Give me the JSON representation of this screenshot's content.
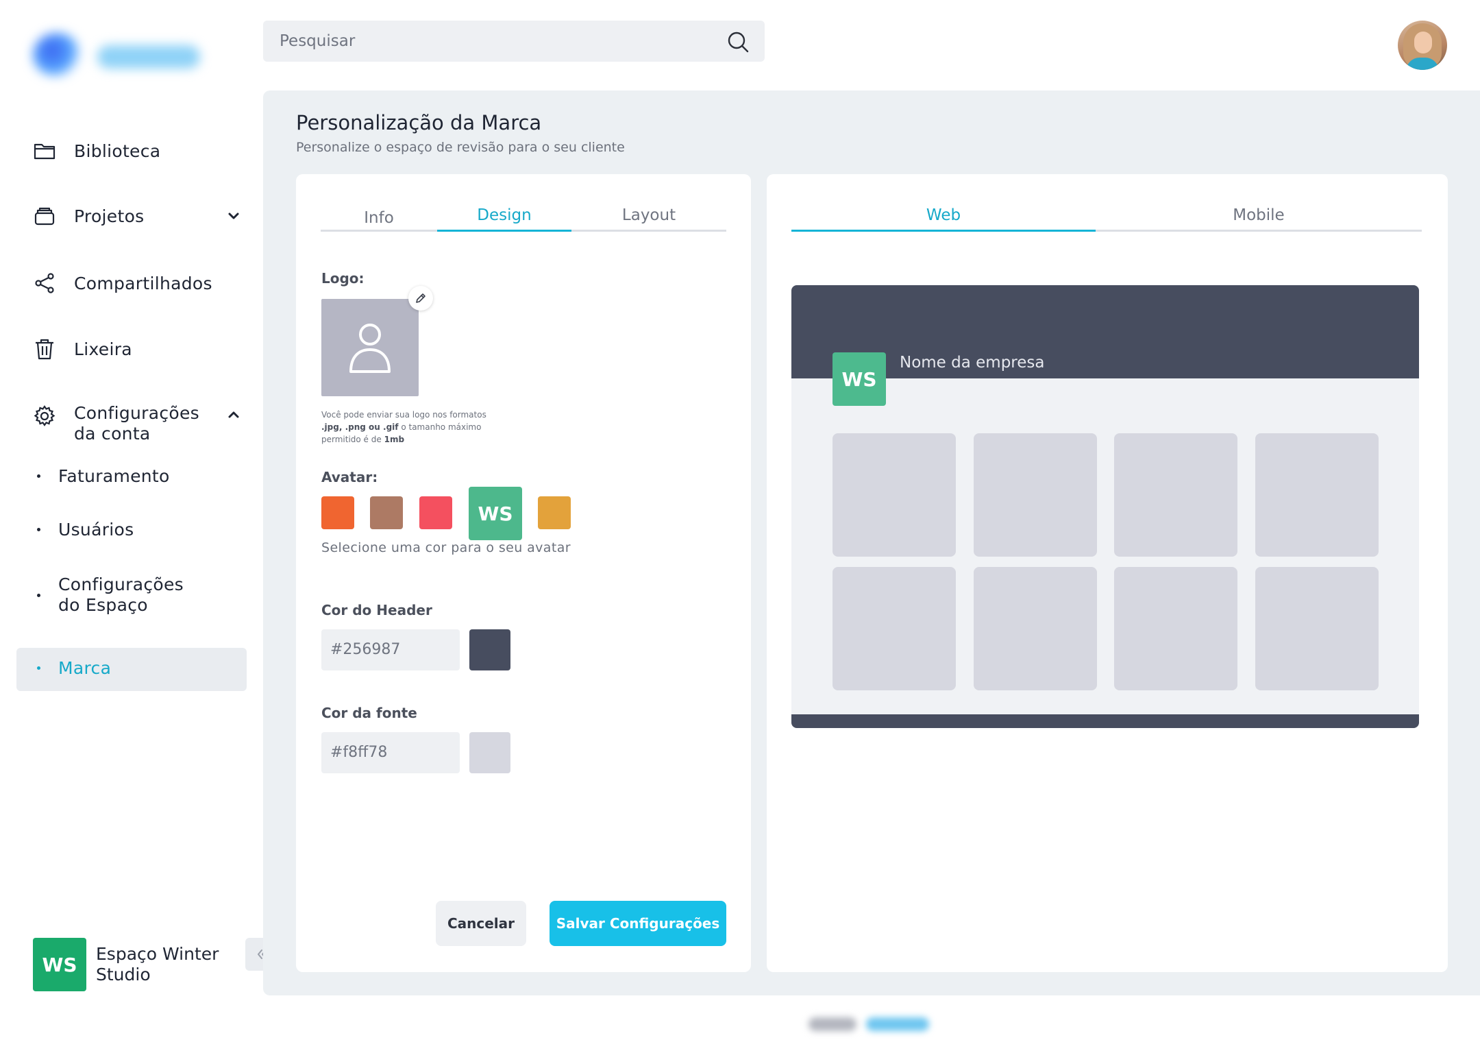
{
  "search": {
    "placeholder": "Pesquisar",
    "value": ""
  },
  "sidebar": {
    "items": [
      {
        "label": "Biblioteca",
        "icon": "folder-icon"
      },
      {
        "label": "Projetos",
        "icon": "projects-icon",
        "expandable": true,
        "expanded": false
      },
      {
        "label": "Compartilhados",
        "icon": "share-icon"
      },
      {
        "label": "Lixeira",
        "icon": "trash-icon"
      },
      {
        "label": "Configurações da conta",
        "icon": "gear-icon",
        "expandable": true,
        "expanded": true
      }
    ],
    "subitems": [
      {
        "label": "Faturamento",
        "active": false
      },
      {
        "label": "Usuários",
        "active": false
      },
      {
        "label": "Configurações do Espaço",
        "active": false
      },
      {
        "label": "Marca",
        "active": true
      }
    ],
    "workspace": {
      "initials": "WS",
      "name": "Espaço Winter Studio",
      "color": "#1aaa6b"
    }
  },
  "page": {
    "title": "Personalização da Marca",
    "subtitle": "Personalize o espaço de revisão para o seu cliente"
  },
  "editor": {
    "tabs": [
      {
        "label": "Info",
        "active": false
      },
      {
        "label": "Design",
        "active": true
      },
      {
        "label": "Layout",
        "active": false
      }
    ],
    "logo": {
      "label": "Logo:",
      "help_prefix": "Você pode enviar sua logo nos formatos",
      "help_formats": ".jpg, .png ou .gif",
      "help_middle": "o tamanho máximo permitido é de",
      "help_size": "1mb"
    },
    "avatar": {
      "label": "Avatar:",
      "initials": "WS",
      "colors": [
        "#f06530",
        "#ad7a64",
        "#f4505f",
        "#4db88c",
        "#e3a23b"
      ],
      "selected_index": 3,
      "hint": "Selecione uma cor para o seu avatar"
    },
    "header_color": {
      "label": "Cor do Header",
      "value": "#256987",
      "swatch": "#474d5f"
    },
    "font_color": {
      "label": "Cor da fonte",
      "value": "#f8ff78",
      "swatch": "#d6d7e0"
    },
    "buttons": {
      "cancel": "Cancelar",
      "save": "Salvar Configurações"
    }
  },
  "preview": {
    "tabs": [
      {
        "label": "Web",
        "active": true
      },
      {
        "label": "Mobile",
        "active": false
      }
    ],
    "badge": "WS",
    "company_name": "Nome da empresa",
    "header_color": "#474d5f",
    "tile_count": 8
  },
  "colors": {
    "accent": "#16a9c9",
    "primary_button": "#18c0e8"
  }
}
